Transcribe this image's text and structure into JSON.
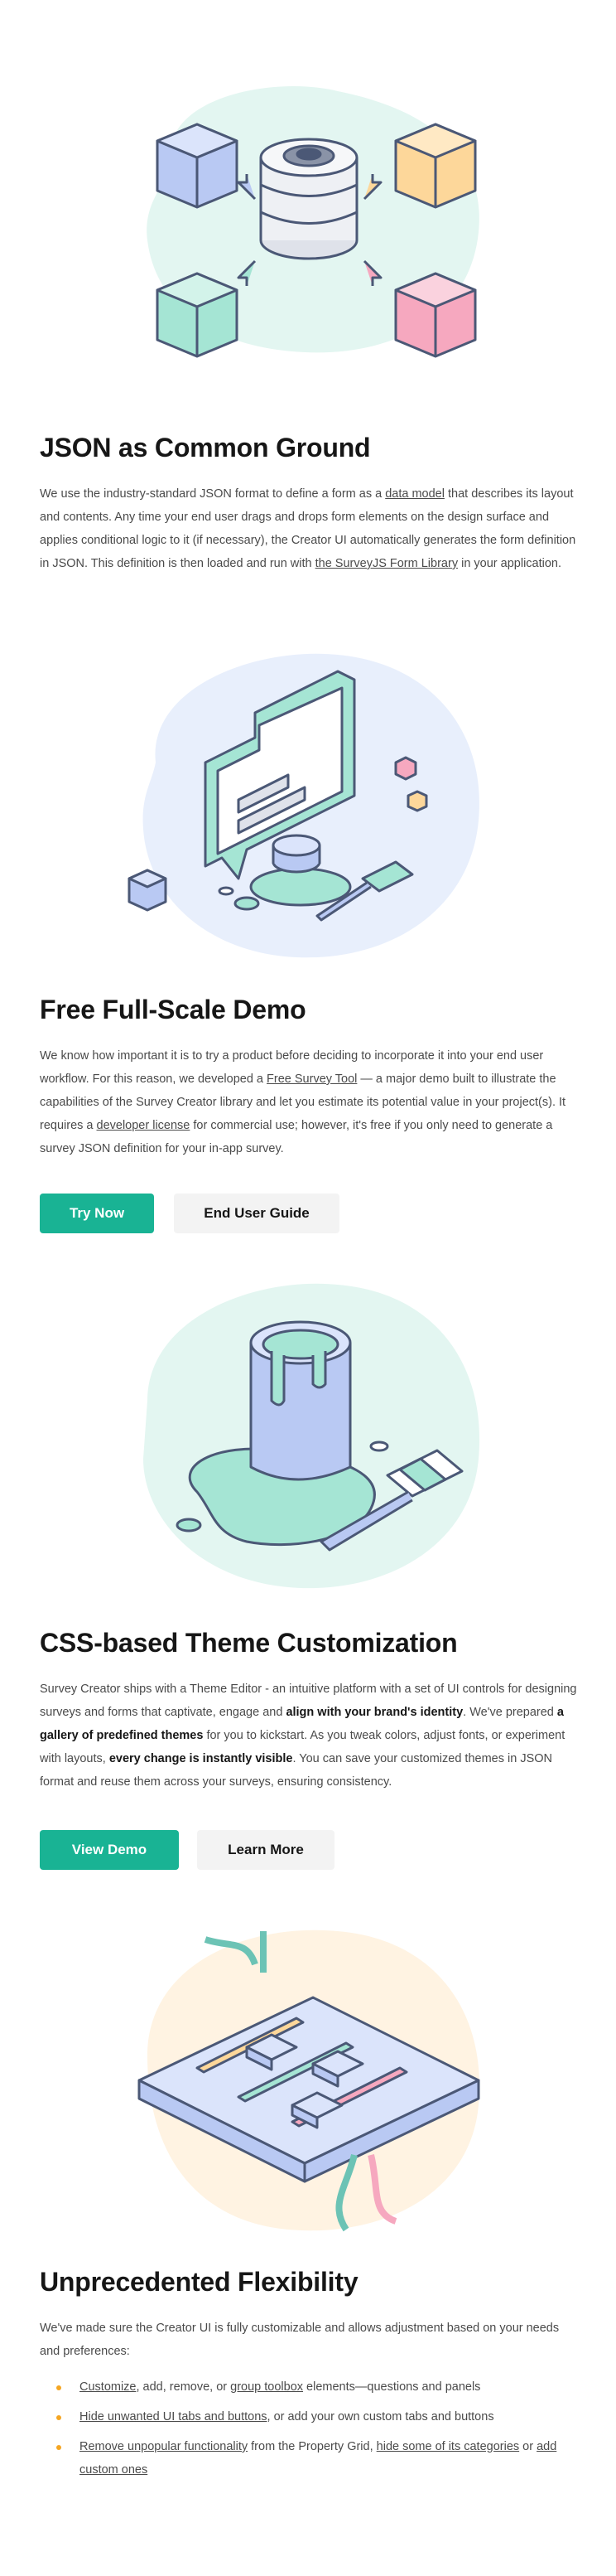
{
  "sections": {
    "json": {
      "title": "JSON as Common Ground",
      "text": {
        "p1": "We use the industry-standard JSON format to define a form as a ",
        "link1": "data model",
        "p2": " that describes its layout and contents. Any time your end user drags and drops form elements on the design surface and applies conditional logic to it (if necessary), the Creator UI automatically generates the form definition in JSON. This definition is then loaded and run with ",
        "link2": "the SurveyJS Form Library",
        "p3": " in your application."
      }
    },
    "demo": {
      "title": "Free Full-Scale Demo",
      "text": {
        "p1": "We know how important it is to try a product before deciding to incorporate it into your end user workflow. For this reason, we developed a ",
        "link1": "Free Survey Tool",
        "p2": " — a major demo built to illustrate the capabilities of the Survey Creator library and let you estimate its potential value in your project(s). It requires a ",
        "link2": "developer license",
        "p3": " for commercial use; however, it's free if you only need to generate a survey JSON definition for your in-app survey."
      },
      "primary_button": "Try Now",
      "secondary_button": "End User Guide"
    },
    "theme": {
      "title": "CSS-based Theme Customization",
      "text": {
        "p1": "Survey Creator ships with a Theme Editor - an intuitive platform with a set of UI controls for designing surveys and forms that captivate, engage and ",
        "b1": "align with your brand's identity",
        "p2": ". We've prepared ",
        "b2": "a gallery of predefined themes",
        "p3": " for you to kickstart. As you tweak colors, adjust fonts, or experiment with layouts, ",
        "b3": "every change is instantly visible",
        "p4": ". You can save your customized themes in JSON format and reuse them across your surveys, ensuring consistency."
      },
      "primary_button": "View Demo",
      "secondary_button": "Learn More"
    },
    "flex": {
      "title": "Unprecedented Flexibility",
      "intro": "We've made sure the Creator UI is fully customizable and allows adjustment based on your needs and preferences:",
      "bullets": [
        {
          "link1": "Customize",
          "t1": ", add, remove, or ",
          "link2": "group toolbox",
          "t2": " elements—questions and panels"
        },
        {
          "link1": "Hide unwanted UI tabs and buttons",
          "t1": ", or add your own custom tabs and buttons"
        },
        {
          "link1": "Remove unpopular functionality",
          "t1": " from the Property Grid, ",
          "link2": "hide some of its categories",
          "t2": " or ",
          "link3": "add custom ones"
        }
      ]
    }
  },
  "colors": {
    "accent": "#19b394",
    "bullet": "#f5a623",
    "blob_green": "#e3f6f1",
    "blob_blue": "#e8effc",
    "blob_orange": "#fff3e2"
  },
  "icons": [
    "database-cubes-illustration",
    "creator-canvas-illustration",
    "paint-bucket-illustration",
    "sliders-board-illustration"
  ]
}
